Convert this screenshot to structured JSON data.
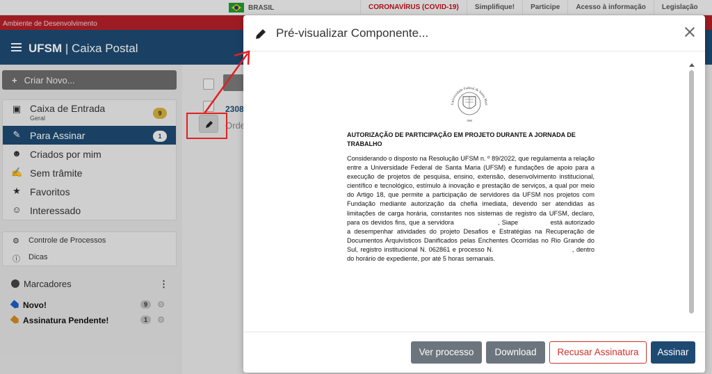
{
  "gov_bar": {
    "country": "BRASIL",
    "links": [
      "CORONAVÍRUS (COVID-19)",
      "Simplifique!",
      "Participe",
      "Acesso à informação",
      "Legislação"
    ]
  },
  "dev_banner": "Ambiente de Desenvolvimento",
  "header": {
    "brand_bold": "UFSM",
    "brand_rest": " | Caixa Postal"
  },
  "sidebar": {
    "new_button": "Criar Novo...",
    "items": [
      {
        "label": "Caixa de Entrada",
        "sublabel": "Geral",
        "badge": "9"
      },
      {
        "label": "Para Assinar",
        "badge": "1"
      },
      {
        "label": "Criados por mim"
      },
      {
        "label": "Sem trâmite"
      },
      {
        "label": "Favoritos"
      },
      {
        "label": "Interessado"
      }
    ],
    "tools": [
      "Controle de Processos",
      "Dicas"
    ],
    "markers_title": "Marcadores",
    "markers": [
      {
        "label": "Novo!",
        "count": "9",
        "color": "#1e5fc2"
      },
      {
        "label": "Assinatura Pendente!",
        "count": "1",
        "color": "#d08a20"
      }
    ]
  },
  "content": {
    "row_title": "2308",
    "row_sub": "Orde"
  },
  "modal": {
    "title": "Pré-visualizar Componente...",
    "doc_title": "AUTORIZAÇÃO DE PARTICIPAÇÃO EM PROJETO DURANTE A JORNADA DE TRABALHO",
    "doc_p1": "Considerando o disposto na Resolução UFSM n. º 89/2022, que regulamenta a relação entre a Universidade Federal de Santa Maria (UFSM) e fundações de apoio para a execução de projetos de pesquisa, ensino, extensão, desenvolvimento institucional, científico e tecnológico, estímulo à inovação e prestação de serviços, a qual por meio do Artigo 18, que permite a participação de servidores da UFSM nos projetos com Fundação mediante autorização da chefia imediata, devendo ser atendidas as limitações de carga horária, constantes nos sistemas de registro da UFSM, declaro, para os devidos fins, que a servidora",
    "doc_siape": ", Siape",
    "doc_p2": "está autorizado a desempenhar atividades do projeto Desafios e Estratégias na Recuperação de Documentos Arquivísticos Danificados pelas Enchentes Ocorridas no Rio Grande do Sul, registro institucional N. 062861 e processo N.",
    "doc_p3": ", dentro do horário de expediente, por até 5 horas semanais.",
    "seal_text": "Universidade Federal de Santa Maria",
    "seal_year": "1960",
    "buttons": {
      "view_process": "Ver processo",
      "download": "Download",
      "refuse": "Recusar Assinatura",
      "sign": "Assinar"
    }
  },
  "colors": {
    "primary": "#1e4a72",
    "danger": "#c9302c",
    "dev_banner": "#b3202a",
    "annotation": "#e02020"
  }
}
